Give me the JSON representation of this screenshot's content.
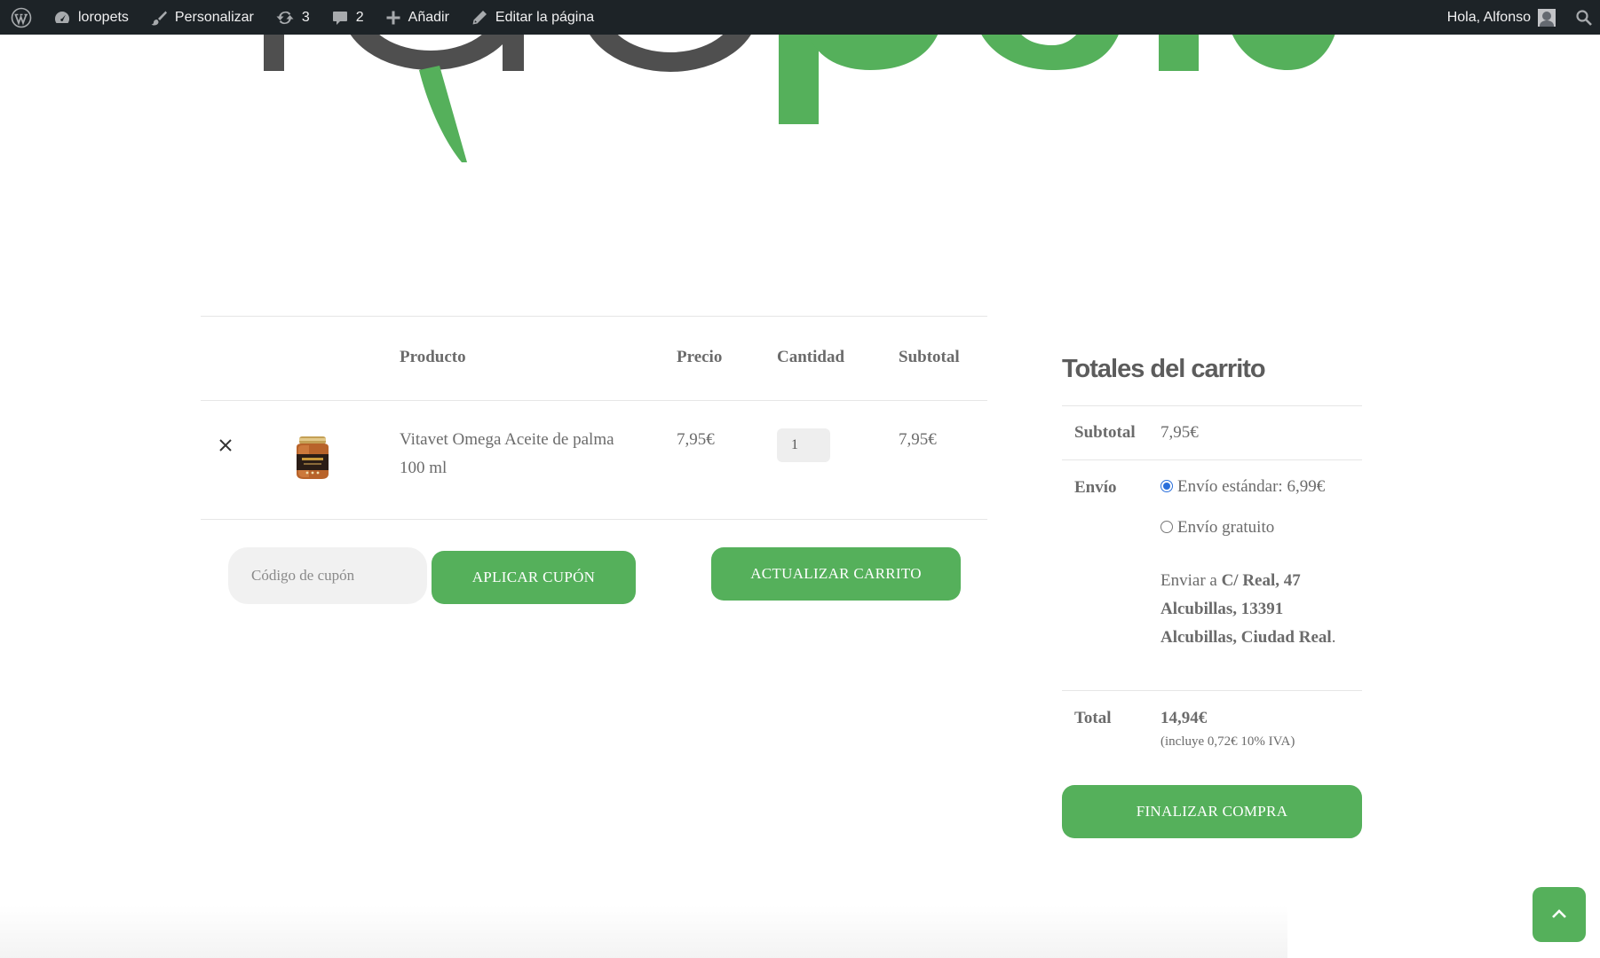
{
  "adminbar": {
    "site_name": "loropets",
    "customize": "Personalizar",
    "updates": "3",
    "comments": "2",
    "new": "Añadir",
    "edit_page": "Editar la página",
    "greeting": "Hola, Alfonso"
  },
  "colors": {
    "brand_green": "#55b05b",
    "logo_gray": "#4f4f4f",
    "adminbar_bg": "#1d2327"
  },
  "cart": {
    "headers": {
      "product": "Producto",
      "price": "Precio",
      "quantity": "Cantidad",
      "subtotal": "Subtotal"
    },
    "items": [
      {
        "name_line1": "Vitavet Omega Aceite de palma",
        "name_line2": "100 ml",
        "price": "7,95€",
        "quantity": "1",
        "subtotal": "7,95€"
      }
    ],
    "coupon_placeholder": "Código de cupón",
    "apply_coupon": "APLICAR CUPÓN",
    "update_cart": "ACTUALIZAR CARRITO"
  },
  "totals": {
    "title": "Totales del carrito",
    "subtotal_label": "Subtotal",
    "subtotal_value": "7,95€",
    "shipping_label": "Envío",
    "shipping_options": [
      {
        "label": "Envío estándar: 6,99€",
        "checked": true
      },
      {
        "label": "Envío gratuito",
        "checked": false
      }
    ],
    "ship_to_prefix": "Enviar a ",
    "ship_to_line1": "C/ Real, 47",
    "ship_to_line2": "Alcubillas, 13391",
    "ship_to_line3": "Alcubillas, Ciudad Real",
    "ship_to_suffix": ".",
    "total_label": "Total",
    "total_value": "14,94€",
    "tax_note": "(incluye 0,72€ 10% IVA)",
    "checkout": "FINALIZAR COMPRA"
  }
}
